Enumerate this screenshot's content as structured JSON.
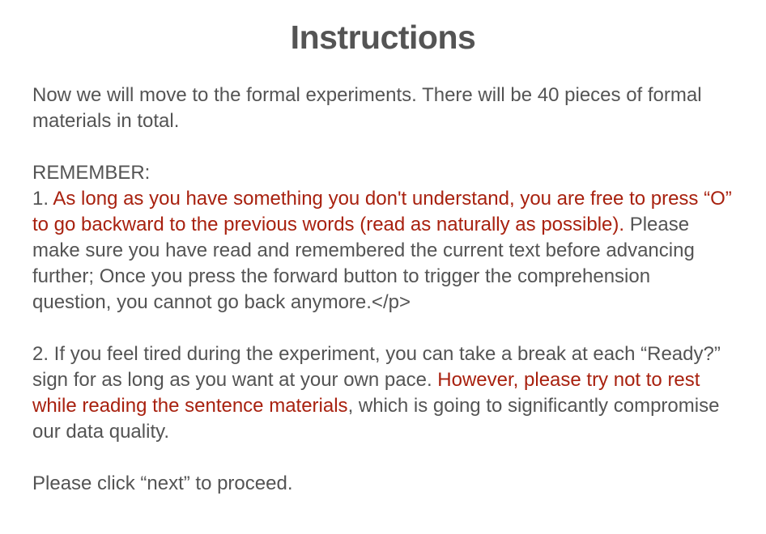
{
  "title": "Instructions",
  "intro": "Now we will move to the formal experiments. There will be 40 pieces of formal materials in total.",
  "remember_label": "REMEMBER:",
  "rule1": {
    "number": "1. ",
    "highlight": "As long as you have something you don't understand, you are free to press “O” to go backward to the previous words (read as naturally as possible).",
    "rest": " Please make sure you have read and remembered the current text before advancing further; Once you press the forward button to trigger the comprehension question, you cannot go back anymore.</p>"
  },
  "rule2": {
    "lead": "2. If you feel tired during the experiment, you can take a break at each “Ready?” sign for as long as you want at your own pace. ",
    "highlight": "However, please try not to rest while reading the sentence materials",
    "rest": ", which is going to significantly compromise our data quality."
  },
  "proceed": "Please click “next” to proceed.",
  "colors": {
    "text": "#545454",
    "highlight": "#a8210f",
    "background": "#ffffff"
  }
}
